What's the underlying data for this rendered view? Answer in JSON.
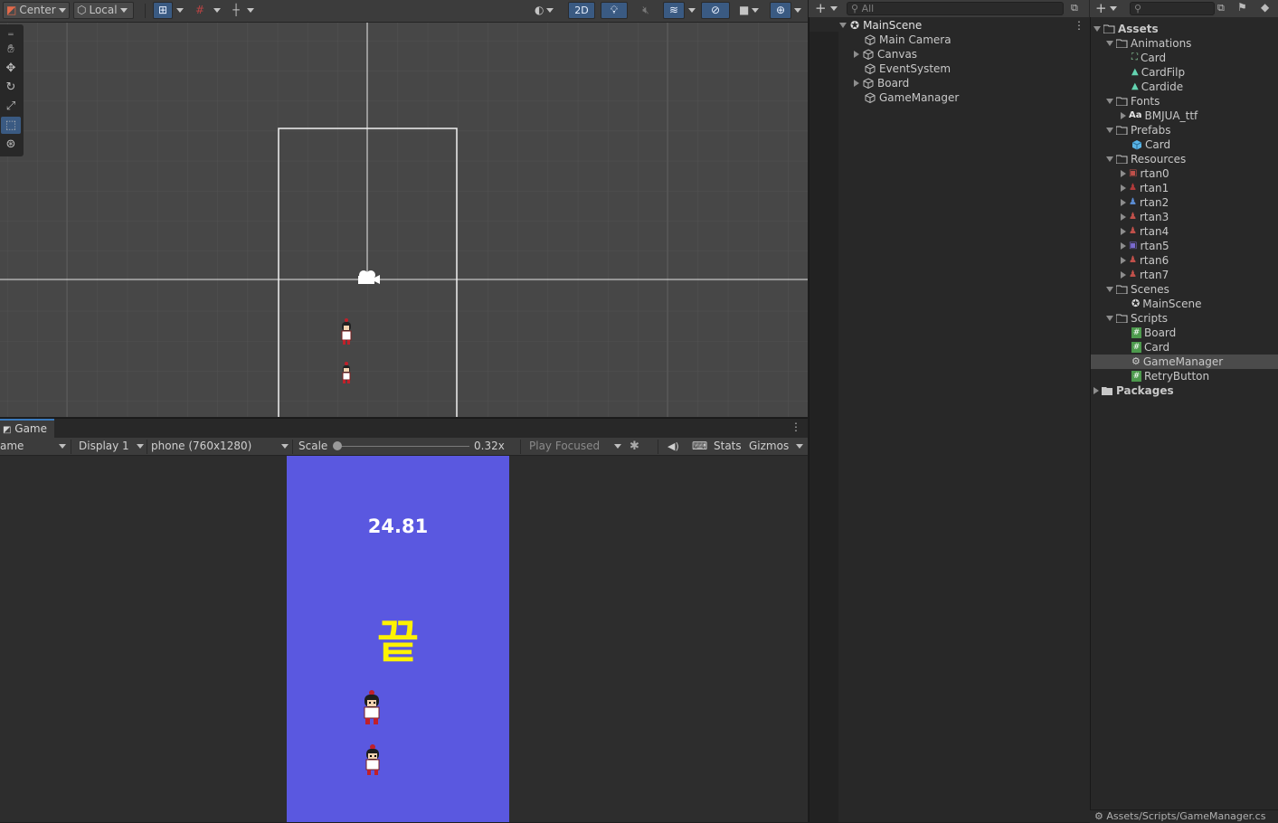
{
  "scene_toolbar": {
    "pivot": "Center",
    "space": "Local",
    "mode_2d": "2D"
  },
  "scene": {
    "tools": [
      "hand-tool",
      "move-tool",
      "rotate-tool",
      "scale-tool",
      "rect-tool",
      "transform-tool"
    ],
    "active_tool": "rect-tool"
  },
  "game": {
    "tab_label": "Game",
    "view_mode": "ame",
    "display": "Display 1",
    "resolution": "phone (760x1280)",
    "scale_label": "Scale",
    "scale_value": "0.32x",
    "play_mode": "Play Focused",
    "stats": "Stats",
    "gizmos": "Gizmos",
    "timer": "24.81",
    "end_text": "끝",
    "background_color": "#5a58e0",
    "timer_color": "#ffffff",
    "end_color": "#fff200"
  },
  "hierarchy": {
    "search_placeholder": "All",
    "scene_name": "MainScene",
    "items": [
      {
        "label": "Main Camera",
        "expandable": false
      },
      {
        "label": "Canvas",
        "expandable": true
      },
      {
        "label": "EventSystem",
        "expandable": false
      },
      {
        "label": "Board",
        "expandable": true
      },
      {
        "label": "GameManager",
        "expandable": false
      }
    ]
  },
  "project": {
    "root": "Assets",
    "animations": {
      "label": "Animations",
      "items": [
        "Card",
        "CardFilp",
        "Cardide"
      ]
    },
    "fonts": {
      "label": "Fonts",
      "items": [
        "BMJUA_ttf"
      ],
      "glyph": "Aa"
    },
    "prefabs": {
      "label": "Prefabs",
      "items": [
        "Card"
      ]
    },
    "resources": {
      "label": "Resources",
      "items": [
        "rtan0",
        "rtan1",
        "rtan2",
        "rtan3",
        "rtan4",
        "rtan5",
        "rtan6",
        "rtan7"
      ]
    },
    "scenes": {
      "label": "Scenes",
      "items": [
        "MainScene"
      ]
    },
    "scripts": {
      "label": "Scripts",
      "items": [
        "Board",
        "Card",
        "GameManager",
        "RetryButton"
      ],
      "selected": "GameManager"
    },
    "packages": "Packages",
    "status_path": "Assets/Scripts/GameManager.cs"
  }
}
